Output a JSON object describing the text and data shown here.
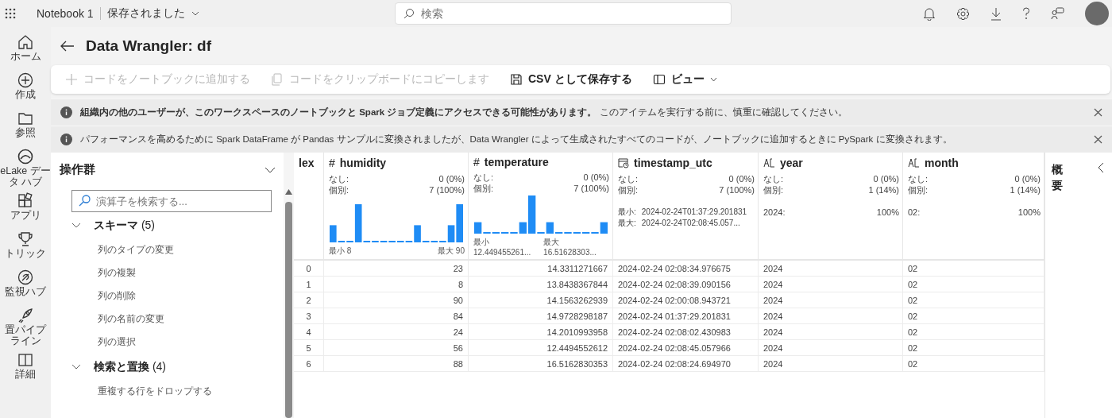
{
  "top_bar": {
    "notebook": "Notebook 1",
    "save_state": "保存されました",
    "search": {
      "placeholder": "検索"
    }
  },
  "rail": [
    {
      "label": "ホーム"
    },
    {
      "label": "作成"
    },
    {
      "label": "参照"
    },
    {
      "label": "eLake データ ハブ"
    },
    {
      "label": "アプリ"
    },
    {
      "label": "トリック"
    },
    {
      "label": "監視ハブ"
    },
    {
      "label": "置パイプライン"
    },
    {
      "label": "詳細"
    }
  ],
  "page": {
    "title": "Data Wrangler: df"
  },
  "toolbar": [
    {
      "label": "コードをノートブックに追加する",
      "disabled": true,
      "dropdown": false
    },
    {
      "label": "コードをクリップボードにコピーします",
      "disabled": true,
      "dropdown": false
    },
    {
      "label": "CSV として保存する",
      "disabled": false,
      "dropdown": false
    },
    {
      "label": "ビュー",
      "disabled": false,
      "dropdown": true
    }
  ],
  "notices": [
    {
      "text": "**組織内の他のユーザーが、このワークスペースのノートブックと Spark ジョブ定義にアクセスできる可能性があります。** このアイテムを実行する前に、慎重に確認してください。"
    },
    {
      "text": "パフォーマンスを高めるために Spark DataFrame が Pandas サンプルに変換されましたが、Data Wrangler によって生成されたすべてのコードが、ノートブックに追加するときに PySpark に変換されます。"
    }
  ],
  "operations": {
    "title": "操作群",
    "search": {
      "placeholder": "演算子を検索する..."
    },
    "groups": [
      {
        "label": "スキーマ",
        "count": "(5)",
        "expanded": true,
        "items": [
          "列のタイプの変更",
          "列の複製",
          "列の削除",
          "列の名前の変更",
          "列の選択"
        ]
      },
      {
        "label": "検索と置換",
        "count": "(4)",
        "expanded": true,
        "items": [
          "重複する行をドロップする"
        ]
      }
    ]
  },
  "grid": {
    "columns": [
      {
        "name": "lex",
        "kind": "index"
      },
      {
        "name": "humidity",
        "kind": "numeric",
        "type_symbol": "#",
        "stats": [
          {
            "label": "なし:",
            "value": "0 (0%)"
          },
          {
            "label": "個別:",
            "value": "7 (100%)"
          }
        ],
        "hist_min": "最小 8",
        "hist_max": "最大 90"
      },
      {
        "name": "temperature",
        "kind": "numeric",
        "type_symbol": "#",
        "stats": [
          {
            "label": "なし:",
            "value": "0 (0%)"
          },
          {
            "label": "個別:",
            "value": "7 (100%)"
          }
        ],
        "hist_min": "最小 12.449455261...",
        "hist_max": "最大 16.51628303..."
      },
      {
        "name": "timestamp_utc",
        "kind": "datetime",
        "stats": [
          {
            "label": "なし:",
            "value": "0 (0%)"
          },
          {
            "label": "個別:",
            "value": "7 (100%)"
          }
        ],
        "range": [
          {
            "label": "最小:",
            "value": "2024-02-24T01:37:29.201831"
          },
          {
            "label": "最大:",
            "value": "2024-02-24T02:08:45.057..."
          }
        ]
      },
      {
        "name": "year",
        "kind": "text",
        "stats": [
          {
            "label": "なし:",
            "value": "0 (0%)"
          },
          {
            "label": "個別:",
            "value": "1 (14%)"
          }
        ],
        "top": [
          {
            "label": "2024:",
            "value": "100%"
          }
        ]
      },
      {
        "name": "month",
        "kind": "text",
        "stats": [
          {
            "label": "なし:",
            "value": "0 (0%)"
          },
          {
            "label": "個別:",
            "value": "1 (14%)"
          }
        ],
        "top": [
          {
            "label": "02:",
            "value": "100%"
          }
        ]
      }
    ],
    "rows": [
      [
        "0",
        "23",
        "14.3311271667",
        "2024-02-24 02:08:34.976675",
        "2024",
        "02"
      ],
      [
        "1",
        "8",
        "13.8438367844",
        "2024-02-24 02:08:39.090156",
        "2024",
        "02"
      ],
      [
        "2",
        "90",
        "14.1563262939",
        "2024-02-24 02:00:08.943721",
        "2024",
        "02"
      ],
      [
        "3",
        "84",
        "14.9728298187",
        "2024-02-24 01:37:29.201831",
        "2024",
        "02"
      ],
      [
        "4",
        "24",
        "14.2010993958",
        "2024-02-24 02:08:02.430983",
        "2024",
        "02"
      ],
      [
        "5",
        "56",
        "12.4494552612",
        "2024-02-24 02:08:45.057966",
        "2024",
        "02"
      ],
      [
        "6",
        "88",
        "16.5162830353",
        "2024-02-24 02:08:24.694970",
        "2024",
        "02"
      ]
    ]
  },
  "summary": {
    "title": "概要"
  }
}
